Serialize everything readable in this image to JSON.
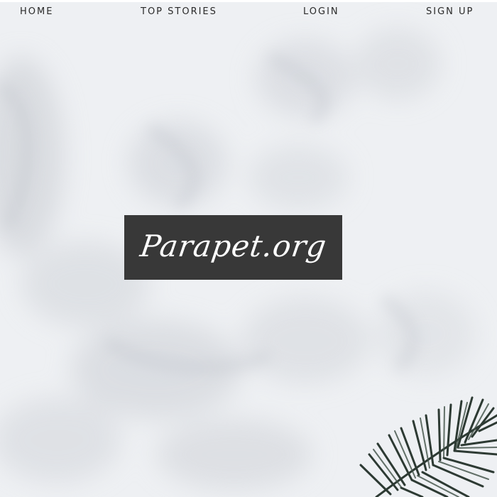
{
  "nav": {
    "home": "HOME",
    "top_stories": "TOP STORIES",
    "login": "LOGIN",
    "sign_up": "SIGN UP"
  },
  "logo": {
    "text": "Parapet.org"
  },
  "colors": {
    "background": "#eceef1",
    "logo_box": "#383838",
    "nav_text": "#2a2a2a",
    "palm": "#2d3a33"
  },
  "icons": {
    "decoration": "palm-leaf-icon"
  }
}
